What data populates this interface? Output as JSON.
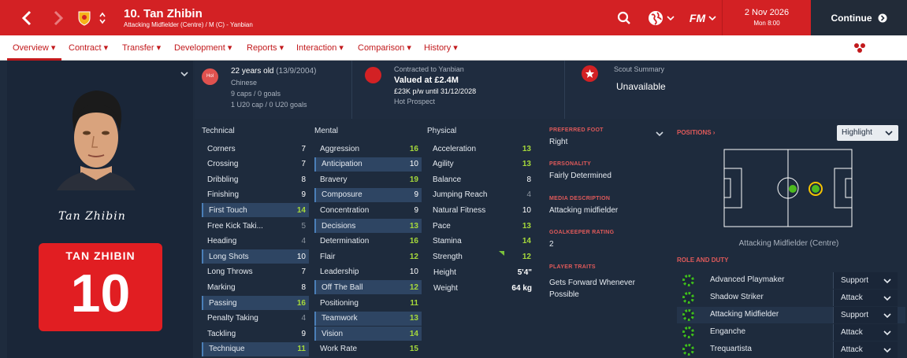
{
  "header": {
    "player_title": "10. Tan Zhibin",
    "player_subtitle": "Attacking Midfielder (Centre) / M (C) - Yanbian",
    "date": "2 Nov 2026",
    "time": "Mon 8:00",
    "continue_label": "Continue",
    "accent_color": "#d32124"
  },
  "tabs": [
    {
      "label": "Overview"
    },
    {
      "label": "Contract"
    },
    {
      "label": "Transfer"
    },
    {
      "label": "Development"
    },
    {
      "label": "Reports"
    },
    {
      "label": "Interaction"
    },
    {
      "label": "Comparison"
    },
    {
      "label": "History"
    }
  ],
  "profile": {
    "signature": "Tan Zhibin",
    "shirt_name": "TAN ZHIBIN",
    "shirt_number": "10"
  },
  "info": {
    "nation_badge": "Hol",
    "age": "22 years old",
    "dob": "(13/9/2004)",
    "nationality": "Chinese",
    "caps": "9 caps / 0 goals",
    "u20_caps": "1 U20 cap / 0 U20 goals",
    "contract_to": "Contracted to Yanbian",
    "value": "Valued at £2.4M",
    "wage": "£23K p/w until 31/12/2028",
    "status": "Hot Prospect",
    "scout_title": "Scout Summary",
    "scout_value": "Unavailable"
  },
  "attributes": {
    "technical_label": "Technical",
    "mental_label": "Mental",
    "physical_label": "Physical",
    "technical": [
      {
        "name": "Corners",
        "value": "7",
        "hl": false
      },
      {
        "name": "Crossing",
        "value": "7",
        "hl": false
      },
      {
        "name": "Dribbling",
        "value": "8",
        "hl": false
      },
      {
        "name": "Finishing",
        "value": "9",
        "hl": false
      },
      {
        "name": "First Touch",
        "value": "14",
        "hl": true
      },
      {
        "name": "Free Kick Taki...",
        "value": "5",
        "hl": false
      },
      {
        "name": "Heading",
        "value": "4",
        "hl": false
      },
      {
        "name": "Long Shots",
        "value": "10",
        "hl": true
      },
      {
        "name": "Long Throws",
        "value": "7",
        "hl": false
      },
      {
        "name": "Marking",
        "value": "8",
        "hl": false
      },
      {
        "name": "Passing",
        "value": "16",
        "hl": true
      },
      {
        "name": "Penalty Taking",
        "value": "4",
        "hl": false
      },
      {
        "name": "Tackling",
        "value": "9",
        "hl": false
      },
      {
        "name": "Technique",
        "value": "11",
        "hl": true
      }
    ],
    "mental": [
      {
        "name": "Aggression",
        "value": "16",
        "hl": false
      },
      {
        "name": "Anticipation",
        "value": "10",
        "hl": true
      },
      {
        "name": "Bravery",
        "value": "19",
        "hl": false
      },
      {
        "name": "Composure",
        "value": "9",
        "hl": true
      },
      {
        "name": "Concentration",
        "value": "9",
        "hl": false
      },
      {
        "name": "Decisions",
        "value": "13",
        "hl": true
      },
      {
        "name": "Determination",
        "value": "16",
        "hl": false
      },
      {
        "name": "Flair",
        "value": "12",
        "hl": false
      },
      {
        "name": "Leadership",
        "value": "10",
        "hl": false
      },
      {
        "name": "Off The Ball",
        "value": "12",
        "hl": true
      },
      {
        "name": "Positioning",
        "value": "11",
        "hl": false
      },
      {
        "name": "Teamwork",
        "value": "13",
        "hl": true
      },
      {
        "name": "Vision",
        "value": "14",
        "hl": true
      },
      {
        "name": "Work Rate",
        "value": "15",
        "hl": false
      }
    ],
    "physical": [
      {
        "name": "Acceleration",
        "value": "13"
      },
      {
        "name": "Agility",
        "value": "13"
      },
      {
        "name": "Balance",
        "value": "8"
      },
      {
        "name": "Jumping Reach",
        "value": "4"
      },
      {
        "name": "Natural Fitness",
        "value": "10"
      },
      {
        "name": "Pace",
        "value": "13"
      },
      {
        "name": "Stamina",
        "value": "14"
      },
      {
        "name": "Strength",
        "value": "12"
      }
    ],
    "height_label": "Height",
    "height": "5'4\"",
    "weight_label": "Weight",
    "weight": "64 kg"
  },
  "details": {
    "preferred_foot_label": "PREFERRED FOOT",
    "preferred_foot": "Right",
    "personality_label": "PERSONALITY",
    "personality": "Fairly Determined",
    "media_label": "MEDIA DESCRIPTION",
    "media": "Attacking midfielder",
    "gk_label": "GOALKEEPER RATING",
    "gk": "2",
    "traits_label": "PLAYER TRAITS",
    "traits": "Gets Forward Whenever Possible"
  },
  "positions": {
    "title": "POSITIONS",
    "highlight_label": "Highlight",
    "position_caption": "Attacking Midfielder (Centre)",
    "role_title": "ROLE AND DUTY",
    "roles": [
      {
        "name": "Advanced Playmaker",
        "duty": "Support"
      },
      {
        "name": "Shadow Striker",
        "duty": "Attack"
      },
      {
        "name": "Attacking Midfielder",
        "duty": "Support"
      },
      {
        "name": "Enganche",
        "duty": "Attack"
      },
      {
        "name": "Trequartista",
        "duty": "Attack"
      }
    ]
  }
}
